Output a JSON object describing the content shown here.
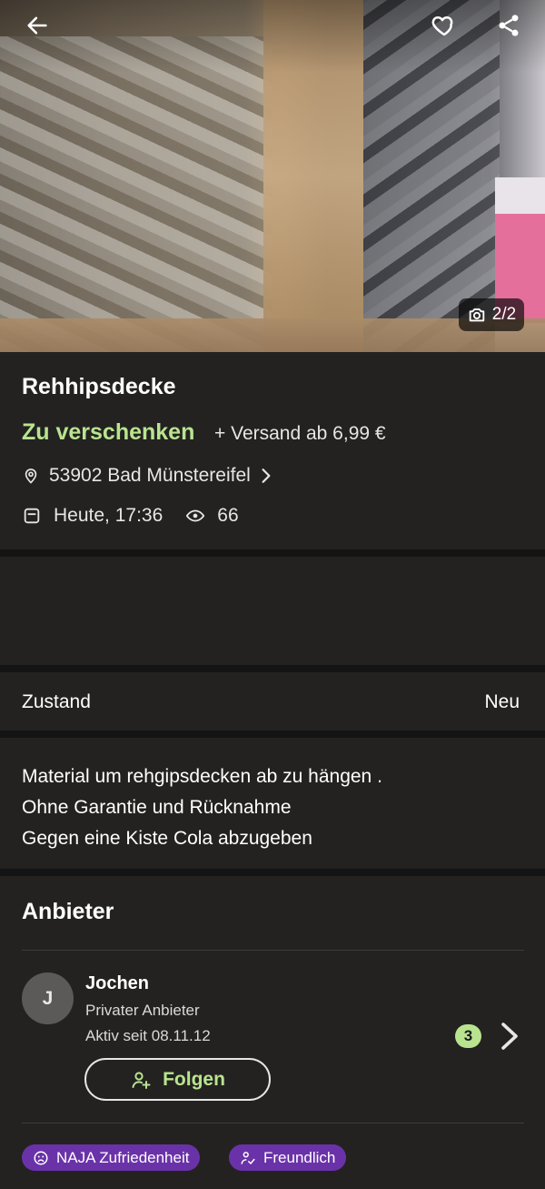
{
  "gallery": {
    "counter": "2/2"
  },
  "listing": {
    "title": "Rehhipsdecke",
    "price": "Zu verschenken",
    "shipping": "+ Versand ab 6,99 €",
    "location": "53902 Bad Münstereifel",
    "date": "Heute, 17:36",
    "views": "66"
  },
  "details": {
    "condition_label": "Zustand",
    "condition_value": "Neu"
  },
  "description": {
    "lines": [
      "Material um rehgipsdecken ab zu hängen .",
      "Ohne Garantie und Rücknahme",
      "Gegen eine Kiste Cola abzugeben"
    ]
  },
  "seller": {
    "heading": "Anbieter",
    "initial": "J",
    "name": "Jochen",
    "type": "Privater Anbieter",
    "active_since": "Aktiv seit 08.11.12",
    "badge_count": "3",
    "follow_label": "Folgen",
    "badges": [
      "NAJA Zufriedenheit",
      "Freundlich"
    ]
  },
  "colors": {
    "accent": "#b9e48f",
    "badge_purple": "#6a32a8",
    "background": "#232221"
  },
  "icons": [
    "back-arrow-icon",
    "heart-icon",
    "share-icon",
    "camera-icon",
    "location-pin-icon",
    "chevron-right-icon",
    "calendar-icon",
    "eye-icon",
    "person-add-icon",
    "neutral-face-icon",
    "friendly-icon"
  ]
}
